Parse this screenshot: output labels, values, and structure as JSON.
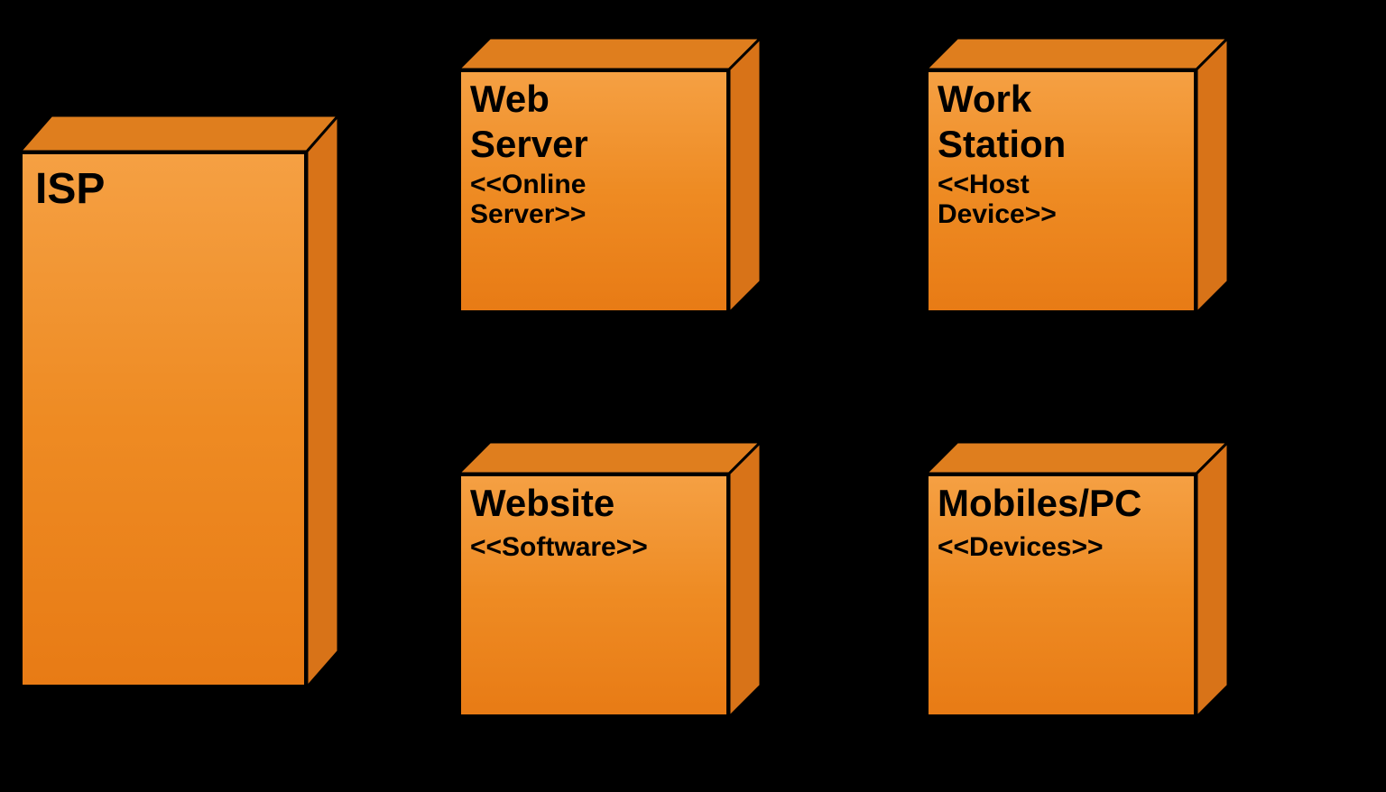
{
  "nodes": {
    "isp": {
      "title": "ISP",
      "stereotype": ""
    },
    "web_server": {
      "title_l1": "Web",
      "title_l2": "Server",
      "stereotype_l1": "<<Online",
      "stereotype_l2": "Server>>"
    },
    "work_station": {
      "title_l1": "Work",
      "title_l2": "Station",
      "stereotype_l1": "<<Host",
      "stereotype_l2": "Device>>"
    },
    "website": {
      "title": "Website",
      "stereotype": "<<Software>>"
    },
    "mobiles_pc": {
      "title": "Mobiles/PC",
      "stereotype": "<<Devices>>"
    }
  }
}
